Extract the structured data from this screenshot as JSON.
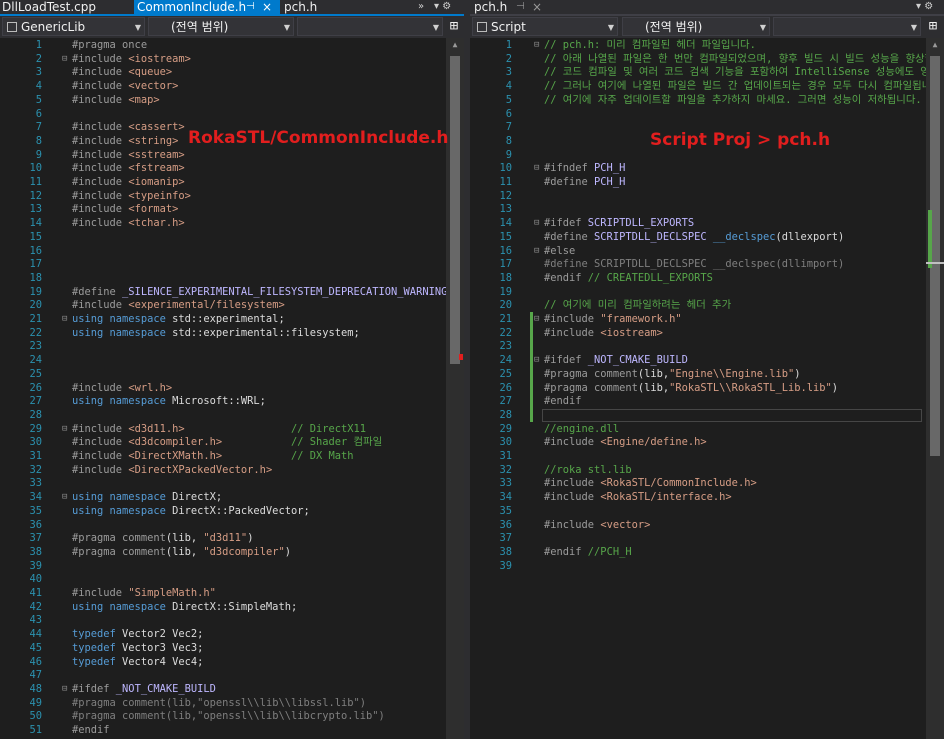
{
  "left": {
    "tabs": [
      {
        "label": "DllLoadTest.cpp",
        "active": false
      },
      {
        "label": "CommonInclude.h",
        "active": true,
        "pin": "⊣",
        "close": "×"
      },
      {
        "label": "pch.h",
        "active": false
      }
    ],
    "tab_tools": "▾ ⚙",
    "nav": {
      "project": "GenericLib",
      "scope": "(전역 범위)",
      "member": ""
    },
    "annotation": "RokaSTL/CommonInclude.h",
    "lines": [
      {
        "n": "1",
        "f": "",
        "seg": [
          [
            "t-pp",
            "#pragma once"
          ]
        ]
      },
      {
        "n": "2",
        "f": "⊟",
        "seg": [
          [
            "t-pp",
            "#include "
          ],
          [
            "t-inc",
            "<iostream>"
          ]
        ]
      },
      {
        "n": "3",
        "f": "",
        "seg": [
          [
            "t-pp",
            "#include "
          ],
          [
            "t-inc",
            "<queue>"
          ]
        ]
      },
      {
        "n": "4",
        "f": "",
        "seg": [
          [
            "t-pp",
            "#include "
          ],
          [
            "t-inc",
            "<vector>"
          ]
        ]
      },
      {
        "n": "5",
        "f": "",
        "seg": [
          [
            "t-pp",
            "#include "
          ],
          [
            "t-inc",
            "<map>"
          ]
        ]
      },
      {
        "n": "6",
        "f": "",
        "seg": []
      },
      {
        "n": "7",
        "f": "",
        "seg": [
          [
            "t-pp",
            "#include "
          ],
          [
            "t-inc",
            "<cassert>"
          ]
        ]
      },
      {
        "n": "8",
        "f": "",
        "seg": [
          [
            "t-pp",
            "#include "
          ],
          [
            "t-inc",
            "<string>"
          ]
        ]
      },
      {
        "n": "9",
        "f": "",
        "seg": [
          [
            "t-pp",
            "#include "
          ],
          [
            "t-inc",
            "<sstream>"
          ]
        ]
      },
      {
        "n": "10",
        "f": "",
        "seg": [
          [
            "t-pp",
            "#include "
          ],
          [
            "t-inc",
            "<fstream>"
          ]
        ]
      },
      {
        "n": "11",
        "f": "",
        "seg": [
          [
            "t-pp",
            "#include "
          ],
          [
            "t-inc",
            "<iomanip>"
          ]
        ]
      },
      {
        "n": "12",
        "f": "",
        "seg": [
          [
            "t-pp",
            "#include "
          ],
          [
            "t-inc",
            "<typeinfo>"
          ]
        ]
      },
      {
        "n": "13",
        "f": "",
        "seg": [
          [
            "t-pp",
            "#include "
          ],
          [
            "t-inc",
            "<format>"
          ]
        ]
      },
      {
        "n": "14",
        "f": "",
        "seg": [
          [
            "t-pp",
            "#include "
          ],
          [
            "t-inc",
            "<tchar.h>"
          ]
        ]
      },
      {
        "n": "15",
        "f": "",
        "seg": []
      },
      {
        "n": "16",
        "f": "",
        "seg": []
      },
      {
        "n": "17",
        "f": "",
        "seg": []
      },
      {
        "n": "18",
        "f": "",
        "seg": []
      },
      {
        "n": "19",
        "f": "",
        "seg": [
          [
            "t-pp",
            "#define "
          ],
          [
            "t-mac",
            "_SILENCE_EXPERIMENTAL_FILESYSTEM_DEPRECATION_WARNING"
          ]
        ]
      },
      {
        "n": "20",
        "f": "",
        "seg": [
          [
            "t-pp",
            "#include "
          ],
          [
            "t-inc",
            "<experimental/filesystem>"
          ]
        ]
      },
      {
        "n": "21",
        "f": "⊟",
        "seg": [
          [
            "t-kw",
            "using namespace "
          ],
          [
            "t-def",
            "std::experimental;"
          ]
        ]
      },
      {
        "n": "22",
        "f": "",
        "seg": [
          [
            "t-kw",
            "using namespace "
          ],
          [
            "t-def",
            "std::experimental::filesystem;"
          ]
        ]
      },
      {
        "n": "23",
        "f": "",
        "seg": []
      },
      {
        "n": "24",
        "f": "",
        "seg": []
      },
      {
        "n": "25",
        "f": "",
        "seg": []
      },
      {
        "n": "26",
        "f": "",
        "seg": [
          [
            "t-pp",
            "#include "
          ],
          [
            "t-inc",
            "<wrl.h>"
          ]
        ]
      },
      {
        "n": "27",
        "f": "",
        "seg": [
          [
            "t-kw",
            "using namespace "
          ],
          [
            "t-def",
            "Microsoft::WRL;"
          ]
        ]
      },
      {
        "n": "28",
        "f": "",
        "seg": []
      },
      {
        "n": "29",
        "f": "⊟",
        "seg": [
          [
            "t-pp",
            "#include "
          ],
          [
            "t-inc",
            "<d3d11.h>"
          ],
          [
            "t-def",
            "                 "
          ],
          [
            "t-cm",
            "// DirectX11"
          ]
        ]
      },
      {
        "n": "30",
        "f": "",
        "seg": [
          [
            "t-pp",
            "#include "
          ],
          [
            "t-inc",
            "<d3dcompiler.h>"
          ],
          [
            "t-def",
            "           "
          ],
          [
            "t-cm",
            "// Shader 컴파일"
          ]
        ]
      },
      {
        "n": "31",
        "f": "",
        "seg": [
          [
            "t-pp",
            "#include "
          ],
          [
            "t-inc",
            "<DirectXMath.h>"
          ],
          [
            "t-def",
            "           "
          ],
          [
            "t-cm",
            "// DX Math"
          ]
        ]
      },
      {
        "n": "32",
        "f": "",
        "seg": [
          [
            "t-pp",
            "#include "
          ],
          [
            "t-inc",
            "<DirectXPackedVector.h>"
          ]
        ]
      },
      {
        "n": "33",
        "f": "",
        "seg": []
      },
      {
        "n": "34",
        "f": "⊟",
        "seg": [
          [
            "t-kw",
            "using namespace "
          ],
          [
            "t-def",
            "DirectX;"
          ]
        ]
      },
      {
        "n": "35",
        "f": "",
        "seg": [
          [
            "t-kw",
            "using namespace "
          ],
          [
            "t-def",
            "DirectX::PackedVector;"
          ]
        ]
      },
      {
        "n": "36",
        "f": "",
        "seg": []
      },
      {
        "n": "37",
        "f": "",
        "seg": [
          [
            "t-pp",
            "#pragma "
          ],
          [
            "t-pp",
            "comment"
          ],
          [
            "t-def",
            "(lib, "
          ],
          [
            "t-str",
            "\"d3d11\""
          ],
          [
            "t-def",
            ")"
          ]
        ]
      },
      {
        "n": "38",
        "f": "",
        "seg": [
          [
            "t-pp",
            "#pragma "
          ],
          [
            "t-pp",
            "comment"
          ],
          [
            "t-def",
            "(lib, "
          ],
          [
            "t-str",
            "\"d3dcompiler\""
          ],
          [
            "t-def",
            ")"
          ]
        ]
      },
      {
        "n": "39",
        "f": "",
        "seg": []
      },
      {
        "n": "40",
        "f": "",
        "seg": []
      },
      {
        "n": "41",
        "f": "",
        "seg": [
          [
            "t-pp",
            "#include "
          ],
          [
            "t-str",
            "\"SimpleMath.h\""
          ]
        ]
      },
      {
        "n": "42",
        "f": "",
        "seg": [
          [
            "t-kw",
            "using namespace "
          ],
          [
            "t-def",
            "DirectX::SimpleMath;"
          ]
        ]
      },
      {
        "n": "43",
        "f": "",
        "seg": []
      },
      {
        "n": "44",
        "f": "",
        "seg": [
          [
            "t-kw",
            "typedef "
          ],
          [
            "t-def",
            "Vector2 Vec2;"
          ]
        ]
      },
      {
        "n": "45",
        "f": "",
        "seg": [
          [
            "t-kw",
            "typedef "
          ],
          [
            "t-def",
            "Vector3 Vec3;"
          ]
        ]
      },
      {
        "n": "46",
        "f": "",
        "seg": [
          [
            "t-kw",
            "typedef "
          ],
          [
            "t-def",
            "Vector4 Vec4;"
          ]
        ]
      },
      {
        "n": "47",
        "f": "",
        "seg": []
      },
      {
        "n": "48",
        "f": "⊟",
        "seg": [
          [
            "t-pp",
            "#ifdef "
          ],
          [
            "t-mac",
            "_NOT_CMAKE_BUILD"
          ]
        ]
      },
      {
        "n": "49",
        "f": "",
        "seg": [
          [
            "t-dim",
            "#pragma comment(lib,"
          ],
          [
            "t-dim",
            "\"openssl\\\\lib\\\\libssl.lib\""
          ],
          [
            "t-dim",
            ")"
          ]
        ]
      },
      {
        "n": "50",
        "f": "",
        "seg": [
          [
            "t-dim",
            "#pragma comment(lib,"
          ],
          [
            "t-dim",
            "\"openssl\\\\lib\\\\libcrypto.lib\""
          ],
          [
            "t-dim",
            ")"
          ]
        ]
      },
      {
        "n": "51",
        "f": "",
        "seg": [
          [
            "t-pp",
            "#endif"
          ]
        ]
      }
    ]
  },
  "right": {
    "tabs": [
      {
        "label": "pch.h",
        "active": false,
        "pin": "⊣",
        "close": "×"
      }
    ],
    "tab_tools": "▾ ⚙",
    "nav": {
      "project": "Script",
      "scope": "(전역 범위)",
      "member": ""
    },
    "annotation": "Script Proj > pch.h",
    "lines": [
      {
        "n": "1",
        "f": "⊟",
        "seg": [
          [
            "t-cm",
            "// pch.h: 미리 컴파일된 헤더 파일입니다."
          ]
        ]
      },
      {
        "n": "2",
        "f": "",
        "seg": [
          [
            "t-cm",
            "// 아래 나열된 파일은 한 번만 컴파일되었으며, 향후 빌드 시 빌드 성능을 향상합니다."
          ]
        ]
      },
      {
        "n": "3",
        "f": "",
        "seg": [
          [
            "t-cm",
            "// 코드 컴파일 및 여러 코드 검색 기능을 포함하여 IntelliSense 성능에도 영향을 미칩니다."
          ]
        ]
      },
      {
        "n": "4",
        "f": "",
        "seg": [
          [
            "t-cm",
            "// 그러나 여기에 나열된 파일은 빌드 간 업데이트되는 경우 모두 다시 컴파일됩니다."
          ]
        ]
      },
      {
        "n": "5",
        "f": "",
        "seg": [
          [
            "t-cm",
            "// 여기에 자주 업데이트할 파일을 추가하지 마세요. 그러면 성능이 저하됩니다."
          ]
        ]
      },
      {
        "n": "6",
        "f": "",
        "seg": []
      },
      {
        "n": "7",
        "f": "",
        "seg": []
      },
      {
        "n": "8",
        "f": "",
        "seg": []
      },
      {
        "n": "9",
        "f": "",
        "seg": []
      },
      {
        "n": "10",
        "f": "⊟",
        "seg": [
          [
            "t-pp",
            "#ifndef "
          ],
          [
            "t-mac",
            "PCH_H"
          ]
        ]
      },
      {
        "n": "11",
        "f": "",
        "seg": [
          [
            "t-pp",
            "#define "
          ],
          [
            "t-mac",
            "PCH_H"
          ]
        ]
      },
      {
        "n": "12",
        "f": "",
        "seg": []
      },
      {
        "n": "13",
        "f": "",
        "seg": []
      },
      {
        "n": "14",
        "f": "⊟",
        "seg": [
          [
            "t-pp",
            "#ifdef "
          ],
          [
            "t-mac",
            "SCRIPTDLL_EXPORTS"
          ]
        ]
      },
      {
        "n": "15",
        "f": "",
        "seg": [
          [
            "t-pp",
            "#define "
          ],
          [
            "t-mac",
            "SCRIPTDLL_DECLSPEC "
          ],
          [
            "t-kw",
            "__declspec"
          ],
          [
            "t-def",
            "(dllexport)"
          ]
        ]
      },
      {
        "n": "16",
        "f": "⊟",
        "seg": [
          [
            "t-pp",
            "#else"
          ]
        ]
      },
      {
        "n": "17",
        "f": "",
        "seg": [
          [
            "t-dim",
            "#define SCRIPTDLL_DECLSPEC "
          ],
          [
            "t-dim",
            "__declspec"
          ],
          [
            "t-dim",
            "(dllimport)"
          ]
        ]
      },
      {
        "n": "18",
        "f": "",
        "seg": [
          [
            "t-pp",
            "#endif "
          ],
          [
            "t-cm",
            "// CREATEDLL_EXPORTS"
          ]
        ]
      },
      {
        "n": "19",
        "f": "",
        "seg": []
      },
      {
        "n": "20",
        "f": "",
        "seg": [
          [
            "t-cm",
            "// 여기에 미리 컴파일하려는 헤더 추가"
          ]
        ]
      },
      {
        "n": "21",
        "f": "⊟",
        "seg": [
          [
            "t-pp",
            "#include "
          ],
          [
            "t-str",
            "\"framework.h\""
          ]
        ]
      },
      {
        "n": "22",
        "f": "",
        "seg": [
          [
            "t-pp",
            "#include "
          ],
          [
            "t-inc",
            "<iostream>"
          ]
        ]
      },
      {
        "n": "23",
        "f": "",
        "seg": []
      },
      {
        "n": "24",
        "f": "⊟",
        "seg": [
          [
            "t-pp",
            "#ifdef "
          ],
          [
            "t-mac",
            "_NOT_CMAKE_BUILD"
          ]
        ]
      },
      {
        "n": "25",
        "f": "",
        "seg": [
          [
            "t-pp",
            "#pragma "
          ],
          [
            "t-pp",
            "comment"
          ],
          [
            "t-def",
            "(lib,"
          ],
          [
            "t-str",
            "\"Engine\\\\Engine.lib\""
          ],
          [
            "t-def",
            ")"
          ]
        ]
      },
      {
        "n": "26",
        "f": "",
        "seg": [
          [
            "t-pp",
            "#pragma "
          ],
          [
            "t-pp",
            "comment"
          ],
          [
            "t-def",
            "(lib,"
          ],
          [
            "t-str",
            "\"RokaSTL\\\\RokaSTL_Lib.lib\""
          ],
          [
            "t-def",
            ")"
          ]
        ]
      },
      {
        "n": "27",
        "f": "",
        "seg": [
          [
            "t-pp",
            "#endif"
          ]
        ]
      },
      {
        "n": "28",
        "f": "",
        "seg": []
      },
      {
        "n": "29",
        "f": "",
        "seg": [
          [
            "t-cm",
            "//engine.dll"
          ]
        ]
      },
      {
        "n": "30",
        "f": "",
        "seg": [
          [
            "t-pp",
            "#include "
          ],
          [
            "t-inc",
            "<Engine/define.h>"
          ]
        ]
      },
      {
        "n": "31",
        "f": "",
        "seg": []
      },
      {
        "n": "32",
        "f": "",
        "seg": [
          [
            "t-cm",
            "//roka stl.lib"
          ]
        ]
      },
      {
        "n": "33",
        "f": "",
        "seg": [
          [
            "t-pp",
            "#include "
          ],
          [
            "t-inc",
            "<RokaSTL/CommonInclude.h>"
          ]
        ]
      },
      {
        "n": "34",
        "f": "",
        "seg": [
          [
            "t-pp",
            "#include "
          ],
          [
            "t-inc",
            "<RokaSTL/interface.h>"
          ]
        ]
      },
      {
        "n": "35",
        "f": "",
        "seg": []
      },
      {
        "n": "36",
        "f": "",
        "seg": [
          [
            "t-pp",
            "#include "
          ],
          [
            "t-inc",
            "<vector>"
          ]
        ]
      },
      {
        "n": "37",
        "f": "",
        "seg": []
      },
      {
        "n": "38",
        "f": "",
        "seg": [
          [
            "t-pp",
            "#endif "
          ],
          [
            "t-cm",
            "//PCH_H"
          ]
        ]
      },
      {
        "n": "39",
        "f": "",
        "seg": []
      }
    ]
  },
  "colors": {
    "accent": "#007acc",
    "annotation": "#e21e1e",
    "change": "#57a64a"
  },
  "icons": {
    "split": "split-pane-icon",
    "dropdown": "chevron-down-icon"
  }
}
